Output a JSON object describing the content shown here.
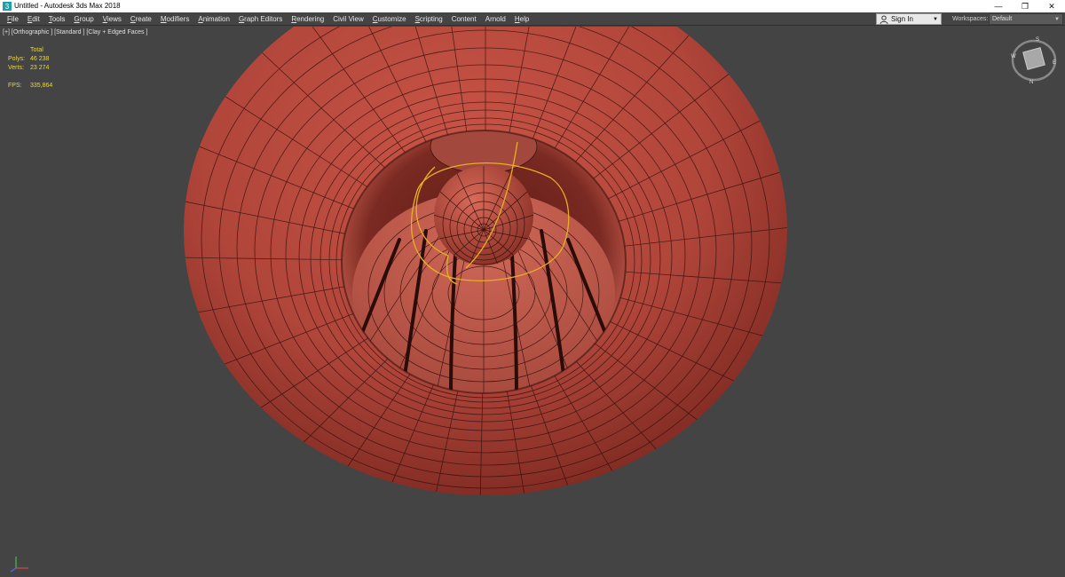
{
  "window": {
    "title": "Untitled - Autodesk 3ds Max 2018",
    "controls": {
      "minimize": "—",
      "maximize": "❐",
      "close": "✕"
    }
  },
  "menubar": {
    "items": [
      "File",
      "Edit",
      "Tools",
      "Group",
      "Views",
      "Create",
      "Modifiers",
      "Animation",
      "Graph Editors",
      "Rendering",
      "Civil View",
      "Customize",
      "Scripting",
      "Content",
      "Arnold",
      "Help"
    ],
    "signin_label": "Sign In",
    "workspaces_label": "Workspaces:",
    "workspace_value": "Default"
  },
  "viewport": {
    "label": "[+] [Orthographic ] [Standard ] [Clay + Edged Faces ]",
    "stats": {
      "header": "Total",
      "polys_label": "Polys:",
      "polys_value": "46 238",
      "verts_label": "Verts:",
      "verts_value": "23 274",
      "fps_label": "FPS:",
      "fps_value": "335,864"
    },
    "viewcube_letters": {
      "north": "N",
      "south": "S",
      "east": "E",
      "west": "W"
    },
    "colors": {
      "clay": "#b8453c",
      "clay_dark": "#6e2018",
      "wire": "#2a0e0a",
      "selection": "#e8b020",
      "background": "#444444"
    }
  }
}
